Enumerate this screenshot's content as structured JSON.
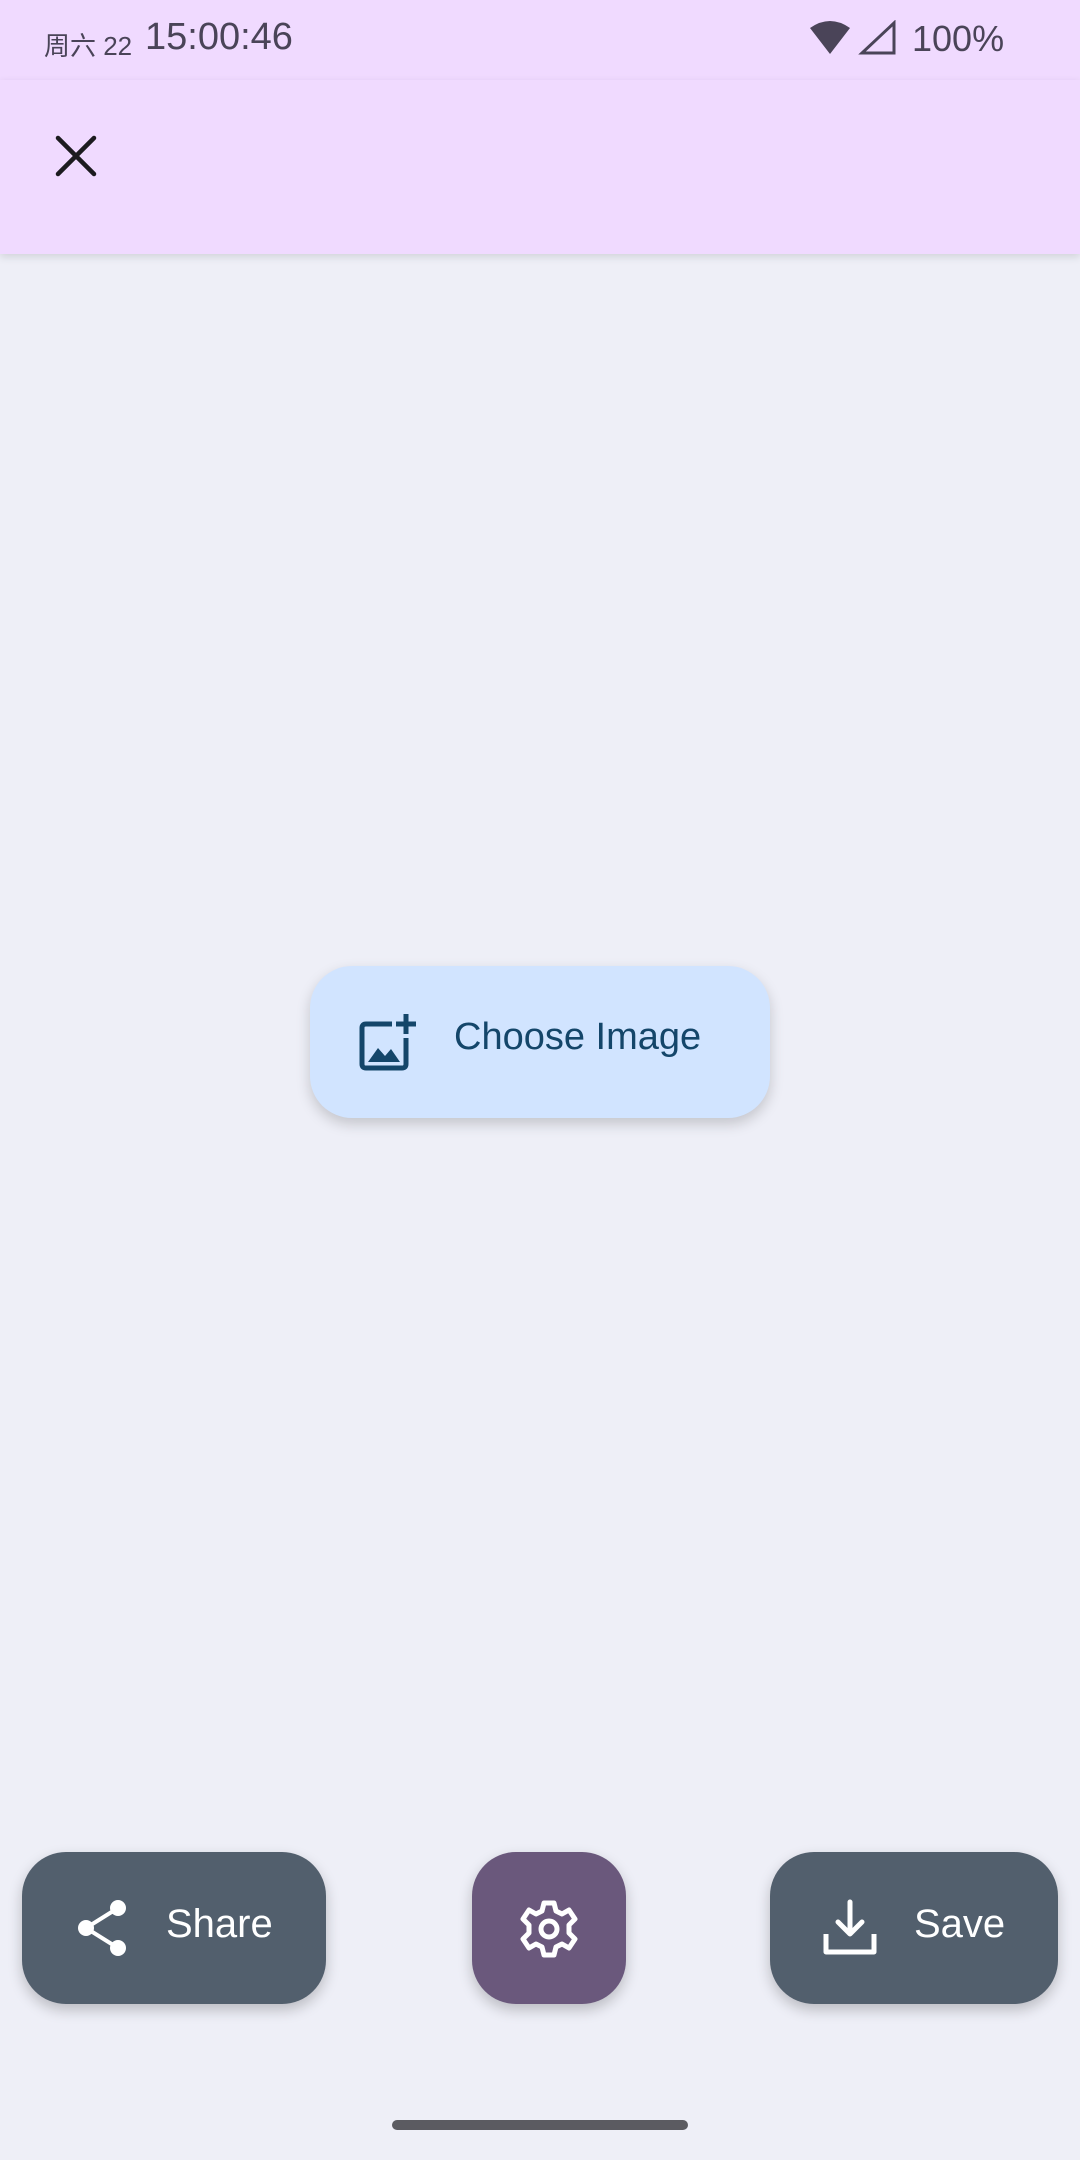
{
  "status_bar": {
    "date": "周六 22",
    "time": "15:00:46",
    "battery": "100%"
  },
  "app_bar": {
    "close_icon": "close-icon"
  },
  "main": {
    "choose_image_label": "Choose Image",
    "choose_image_icon": "add-photo-icon"
  },
  "bottom_actions": {
    "share_label": "Share",
    "share_icon": "share-icon",
    "settings_icon": "gear-icon",
    "save_label": "Save",
    "save_icon": "download-icon"
  },
  "colors": {
    "app_bar_bg": "#f0daff",
    "background": "#eeeff7",
    "choose_button_bg": "#d1e4ff",
    "choose_button_fg": "#14466a",
    "fab_dark": "#525f6d",
    "fab_settings": "#6a587c"
  }
}
